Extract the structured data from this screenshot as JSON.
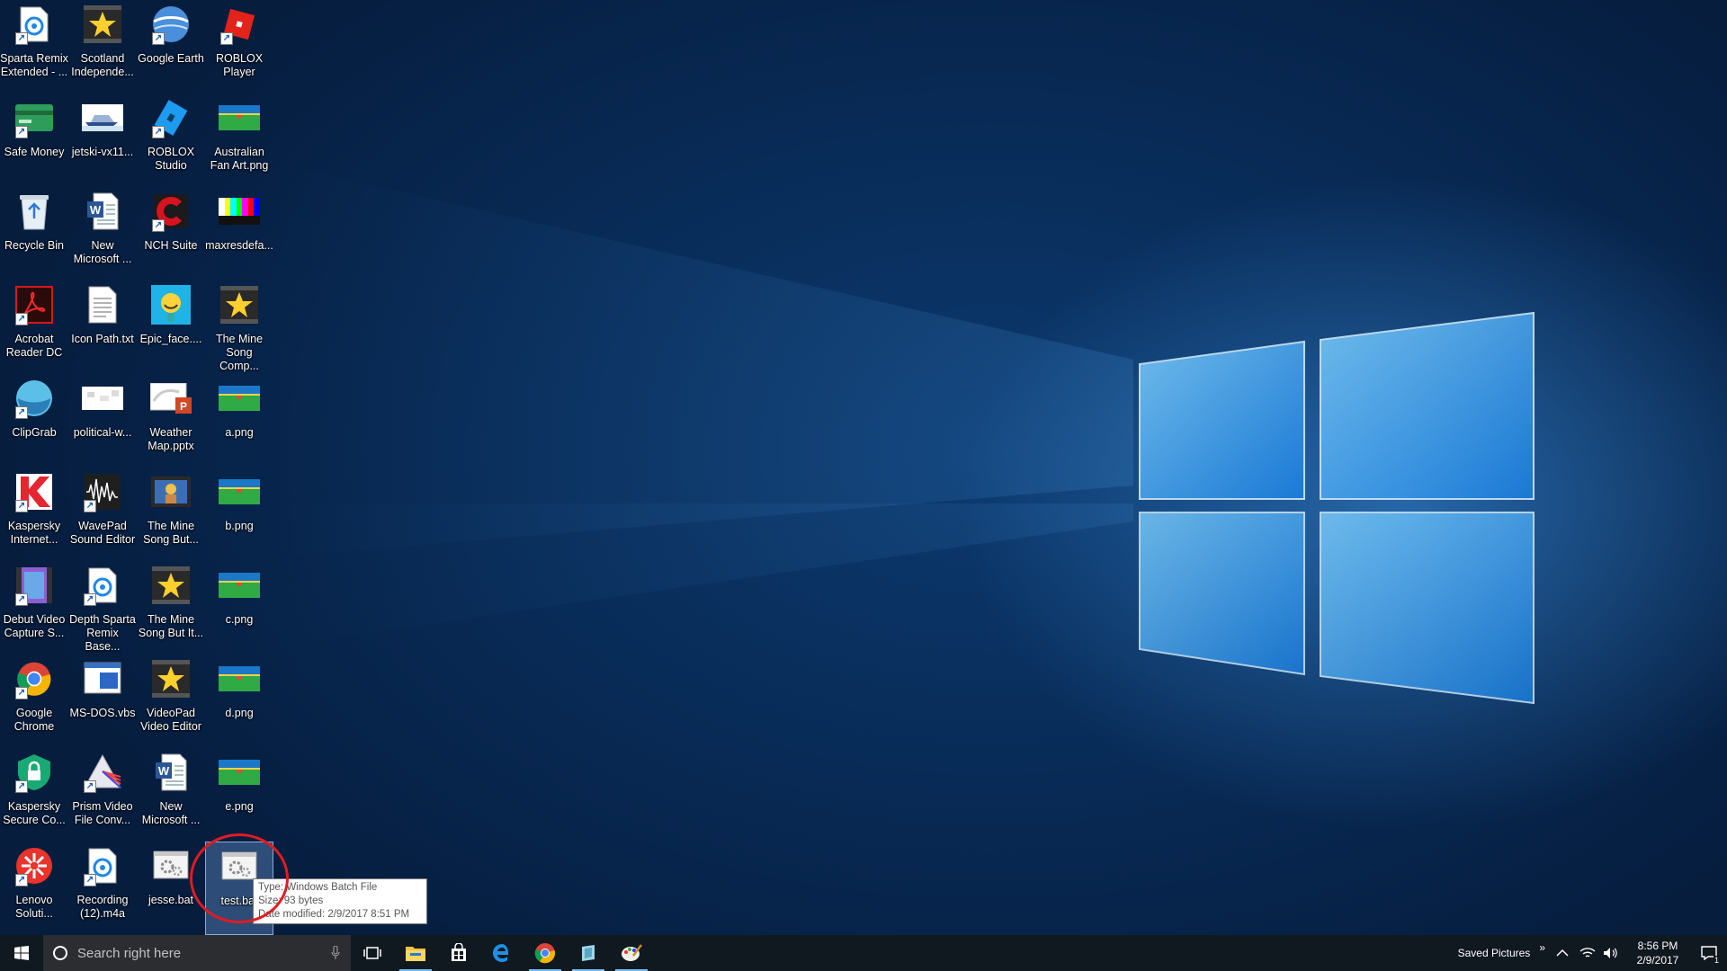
{
  "desktop_icons": [
    {
      "label": "Sparta Remix\nExtended - ...",
      "icon": "sparta-remix-icon"
    },
    {
      "label": "Scotland\nIndepende...",
      "icon": "star-video-icon"
    },
    {
      "label": "Google Earth",
      "icon": "google-earth-icon"
    },
    {
      "label": "ROBLOX\nPlayer",
      "icon": "roblox-player-icon"
    },
    {
      "label": "Safe Money",
      "icon": "safe-money-icon"
    },
    {
      "label": "jetski-vx11...",
      "icon": "jetski-image-icon"
    },
    {
      "label": "ROBLOX\nStudio",
      "icon": "roblox-studio-icon"
    },
    {
      "label": "Australian\nFan Art.png",
      "icon": "flag-image-icon"
    },
    {
      "label": "Recycle Bin",
      "icon": "recycle-bin-icon"
    },
    {
      "label": "New\nMicrosoft ...",
      "icon": "word-document-icon"
    },
    {
      "label": "NCH Suite",
      "icon": "nch-suite-icon"
    },
    {
      "label": "maxresdefa...",
      "icon": "color-bars-image-icon"
    },
    {
      "label": "Acrobat\nReader DC",
      "icon": "acrobat-reader-icon"
    },
    {
      "label": "Icon Path.txt",
      "icon": "text-file-icon"
    },
    {
      "label": "Epic_face....",
      "icon": "epic-face-image-icon"
    },
    {
      "label": "The Mine\nSong Comp...",
      "icon": "star-video-icon"
    },
    {
      "label": "ClipGrab",
      "icon": "clipgrab-icon"
    },
    {
      "label": "political-w...",
      "icon": "political-image-icon"
    },
    {
      "label": "Weather\nMap.pptx",
      "icon": "powerpoint-file-icon"
    },
    {
      "label": "a.png",
      "icon": "flag-image-icon"
    },
    {
      "label": "Kaspersky\nInternet...",
      "icon": "kaspersky-icon"
    },
    {
      "label": "WavePad\nSound Editor",
      "icon": "wavepad-icon"
    },
    {
      "label": "The Mine\nSong But...",
      "icon": "video-thumbnail-icon"
    },
    {
      "label": "b.png",
      "icon": "flag-image-icon"
    },
    {
      "label": "Debut Video\nCapture S...",
      "icon": "debut-video-icon"
    },
    {
      "label": "Depth Sparta\nRemix Base...",
      "icon": "sparta-remix-icon"
    },
    {
      "label": "The Mine\nSong But It...",
      "icon": "star-video-icon"
    },
    {
      "label": "c.png",
      "icon": "flag-image-icon"
    },
    {
      "label": "Google\nChrome",
      "icon": "chrome-icon"
    },
    {
      "label": "MS-DOS.vbs",
      "icon": "vbs-script-icon"
    },
    {
      "label": "VideoPad\nVideo Editor",
      "icon": "star-video-icon"
    },
    {
      "label": "d.png",
      "icon": "flag-image-icon"
    },
    {
      "label": "Kaspersky\nSecure Co...",
      "icon": "kaspersky-secure-icon"
    },
    {
      "label": "Prism Video\nFile Conv...",
      "icon": "prism-video-icon"
    },
    {
      "label": "New\nMicrosoft ...",
      "icon": "word-document-icon"
    },
    {
      "label": "e.png",
      "icon": "flag-image-icon"
    },
    {
      "label": "Lenovo\nSoluti...",
      "icon": "lenovo-solutions-icon"
    },
    {
      "label": "Recording\n(12).m4a",
      "icon": "sparta-remix-icon"
    },
    {
      "label": "jesse.bat",
      "icon": "batch-file-icon"
    },
    {
      "label": "test.bat",
      "icon": "batch-file-icon",
      "selected": true
    }
  ],
  "tooltip": {
    "type_line": "Type: Windows Batch File",
    "size_line": "Size: 93 bytes",
    "date_line": "Date modified: 2/9/2017 8:51 PM"
  },
  "taskbar": {
    "search_placeholder": "Search right here",
    "pinned": [
      "file-explorer-icon",
      "store-icon",
      "edge-icon",
      "chrome-icon",
      "unknown-app-icon",
      "paint-icon"
    ],
    "tray_label": "Saved Pictures",
    "overflow": "»",
    "time": "8:56 PM",
    "date": "2/9/2017",
    "notification_count": "1"
  },
  "colors": {
    "taskbar": "#101820",
    "selection": "#78aae6",
    "annotation": "#e11b22",
    "accent": "#76b9ed"
  }
}
